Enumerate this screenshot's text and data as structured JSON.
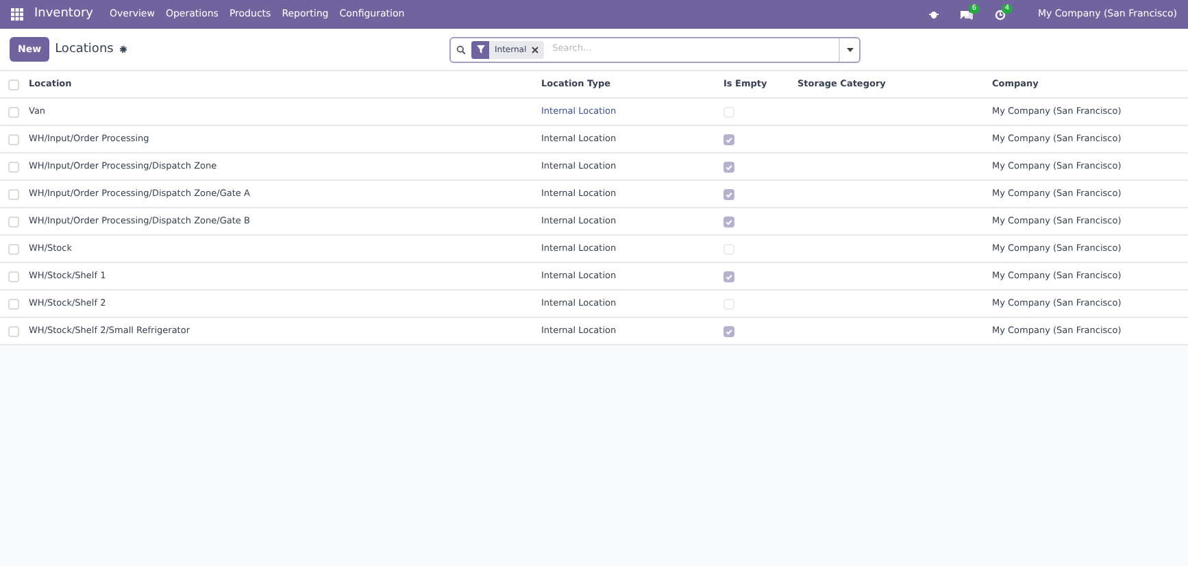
{
  "navbar": {
    "app": "Inventory",
    "menu": [
      "Overview",
      "Operations",
      "Products",
      "Reporting",
      "Configuration"
    ],
    "messages_count": "6",
    "activities_count": "4",
    "company": "My Company (San Francisco)"
  },
  "control_panel": {
    "new_button": "New",
    "title": "Locations",
    "search": {
      "facet": "Internal",
      "placeholder": "Search..."
    }
  },
  "table": {
    "all_selected": false,
    "columns": [
      "Location",
      "Location Type",
      "Is Empty",
      "Storage Category",
      "Company"
    ],
    "rows": [
      {
        "location": "Van",
        "location_type": "Internal Location",
        "is_empty": false,
        "company": "My Company (San Francisco)",
        "hovered": true,
        "selected": false
      },
      {
        "location": "WH/Input/Order Processing",
        "location_type": "Internal Location",
        "is_empty": true,
        "company": "My Company (San Francisco)",
        "hovered": false,
        "selected": false
      },
      {
        "location": "WH/Input/Order Processing/Dispatch Zone",
        "location_type": "Internal Location",
        "is_empty": true,
        "company": "My Company (San Francisco)",
        "hovered": false,
        "selected": false
      },
      {
        "location": "WH/Input/Order Processing/Dispatch Zone/Gate A",
        "location_type": "Internal Location",
        "is_empty": true,
        "company": "My Company (San Francisco)",
        "hovered": false,
        "selected": false
      },
      {
        "location": "WH/Input/Order Processing/Dispatch Zone/Gate B",
        "location_type": "Internal Location",
        "is_empty": true,
        "company": "My Company (San Francisco)",
        "hovered": false,
        "selected": false
      },
      {
        "location": "WH/Stock",
        "location_type": "Internal Location",
        "is_empty": false,
        "company": "My Company (San Francisco)",
        "hovered": false,
        "selected": false
      },
      {
        "location": "WH/Stock/Shelf 1",
        "location_type": "Internal Location",
        "is_empty": true,
        "company": "My Company (San Francisco)",
        "hovered": false,
        "selected": false
      },
      {
        "location": "WH/Stock/Shelf 2",
        "location_type": "Internal Location",
        "is_empty": false,
        "company": "My Company (San Francisco)",
        "hovered": false,
        "selected": false
      },
      {
        "location": "WH/Stock/Shelf 2/Small Refrigerator",
        "location_type": "Internal Location",
        "is_empty": true,
        "company": "My Company (San Francisco)",
        "hovered": false,
        "selected": false
      }
    ]
  }
}
